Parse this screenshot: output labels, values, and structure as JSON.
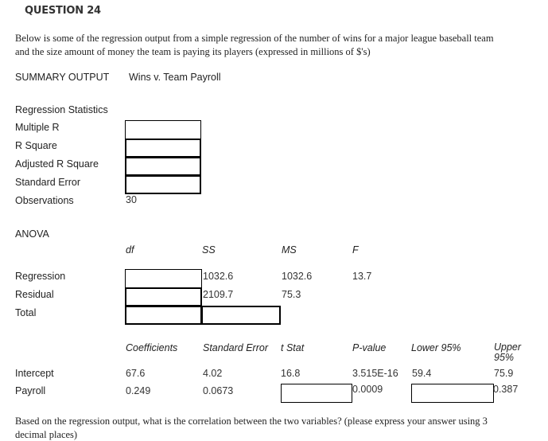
{
  "question": {
    "title": "QUESTION 24",
    "intro_line1": "Below is some of the regression output from a simple regression of the number of wins for a major league baseball team",
    "intro_line2": "and the size amount of money the team is paying its players (expressed in millions of $'s)",
    "prompt_line1": "Based on the regression output, what is the correlation between the two variables? (please express your answer using 3",
    "prompt_line2": "decimal places)"
  },
  "summary": {
    "label": "SUMMARY OUTPUT",
    "subtitle": "Wins v. Team Payroll"
  },
  "regression_statistics": {
    "heading": "Regression Statistics",
    "rows": [
      {
        "label": "Multiple R",
        "value": ""
      },
      {
        "label": "R Square",
        "value": ""
      },
      {
        "label": "Adjusted R Square",
        "value": ""
      },
      {
        "label": "Standard Error",
        "value": ""
      },
      {
        "label": "Observations",
        "value": "30"
      }
    ]
  },
  "anova": {
    "heading": "ANOVA",
    "columns": [
      "df",
      "SS",
      "MS",
      "F"
    ],
    "rows": [
      {
        "label": "Regression",
        "df": "",
        "ss": "1032.6",
        "ms": "1032.6",
        "f": "13.7"
      },
      {
        "label": "Residual",
        "df": "",
        "ss": "2109.7",
        "ms": "75.3",
        "f": ""
      },
      {
        "label": "Total",
        "df": "",
        "ss": "",
        "ms": "",
        "f": ""
      }
    ]
  },
  "coefficients": {
    "columns": [
      "Coefficients",
      "Standard Error",
      "t Stat",
      "P-value",
      "Lower 95%",
      "Upper 95%"
    ],
    "upper_col_line1": "Upper",
    "upper_col_line2": "95%",
    "rows": [
      {
        "label": "Intercept",
        "coef": "67.6",
        "se": "4.02",
        "t": "16.8",
        "p": "3.515E-16",
        "lower": "59.4",
        "upper": "75.9"
      },
      {
        "label": "Payroll",
        "coef": "0.249",
        "se": "0.0673",
        "t": "",
        "p": "0.0009",
        "lower": "",
        "upper": "0.387"
      }
    ]
  }
}
